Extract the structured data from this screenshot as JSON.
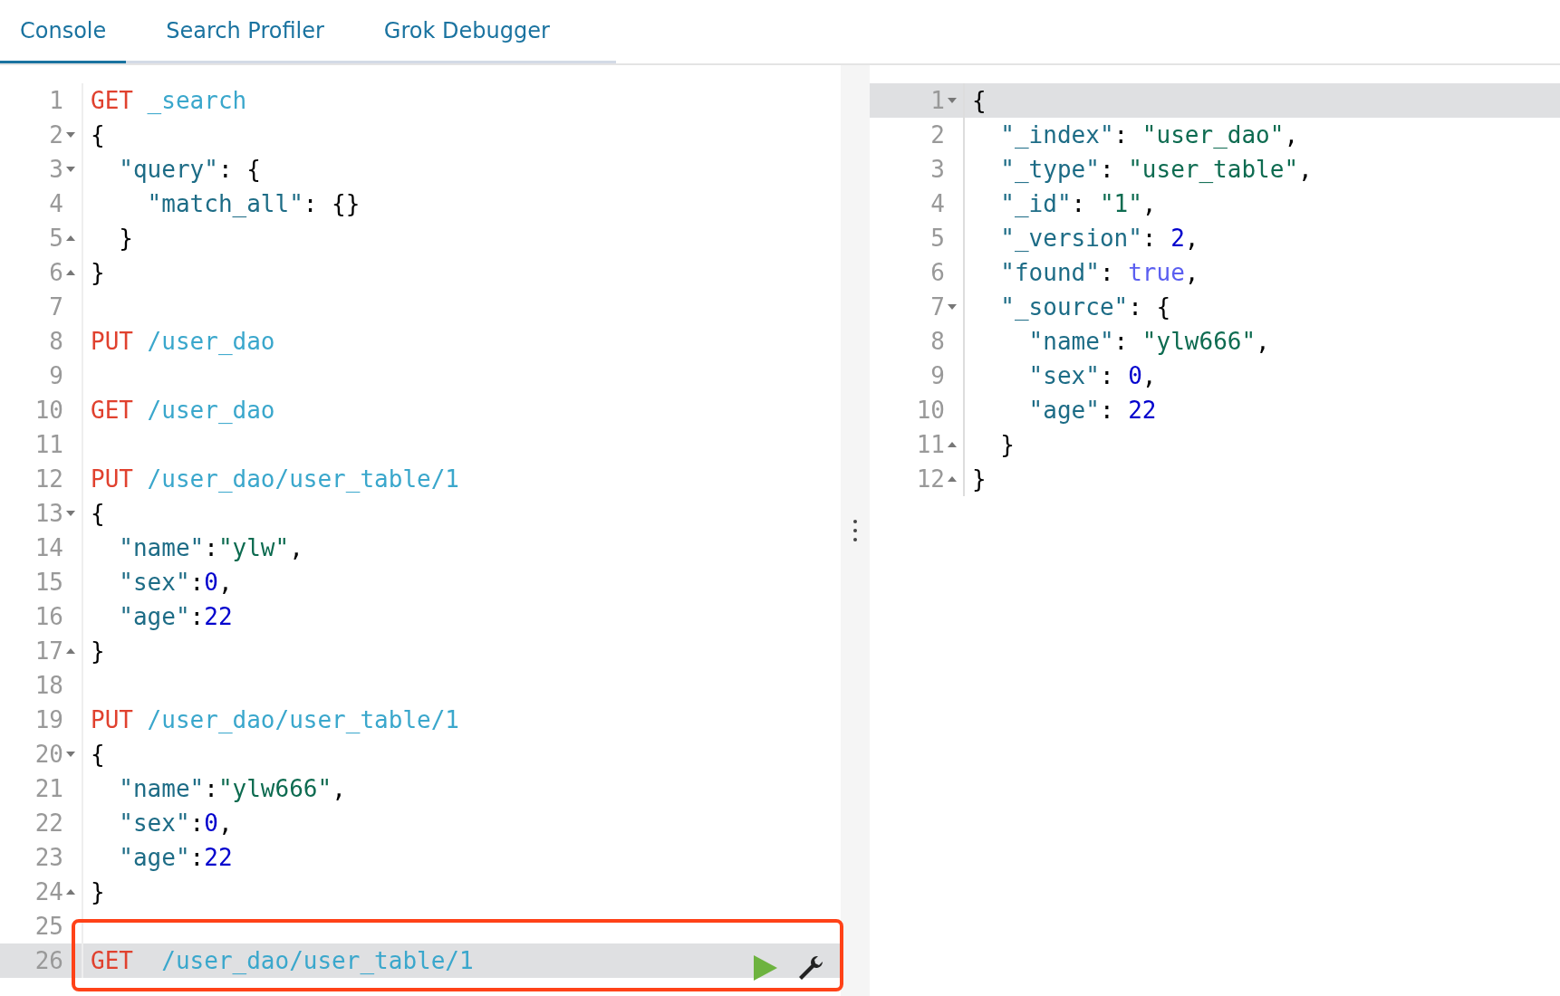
{
  "tabs": [
    {
      "label": "Console",
      "selected": true
    },
    {
      "label": "Search Profiler",
      "selected": false
    },
    {
      "label": "Grok Debugger",
      "selected": false
    }
  ],
  "request_editor": {
    "lines": [
      {
        "number": "1",
        "kind": "plain",
        "active": false,
        "tokens": [
          {
            "kind": "method",
            "text": "GET"
          },
          {
            "kind": "path",
            "text": " _search"
          }
        ]
      },
      {
        "number": "2",
        "kind": "fold-start",
        "active": false,
        "tokens": [
          {
            "kind": "punct",
            "text": "{"
          }
        ]
      },
      {
        "number": "3",
        "kind": "fold-start",
        "active": false,
        "tokens": [
          {
            "kind": "key",
            "text": "  \"query\""
          },
          {
            "kind": "punct",
            "text": ": {"
          }
        ]
      },
      {
        "number": "4",
        "kind": "plain",
        "active": false,
        "tokens": [
          {
            "kind": "key",
            "text": "    \"match_all\""
          },
          {
            "kind": "punct",
            "text": ": {}"
          }
        ]
      },
      {
        "number": "5",
        "kind": "fold-end",
        "active": false,
        "tokens": [
          {
            "kind": "punct",
            "text": "  }"
          }
        ]
      },
      {
        "number": "6",
        "kind": "fold-end",
        "active": false,
        "tokens": [
          {
            "kind": "punct",
            "text": "}"
          }
        ]
      },
      {
        "number": "7",
        "kind": "plain",
        "active": false
      },
      {
        "number": "8",
        "kind": "plain",
        "active": false,
        "tokens": [
          {
            "kind": "method",
            "text": "PUT"
          },
          {
            "kind": "path",
            "text": " /user_dao"
          }
        ]
      },
      {
        "number": "9",
        "kind": "plain",
        "active": false
      },
      {
        "number": "10",
        "kind": "plain",
        "active": false,
        "tokens": [
          {
            "kind": "method",
            "text": "GET"
          },
          {
            "kind": "path",
            "text": " /user_dao"
          }
        ]
      },
      {
        "number": "11",
        "kind": "plain",
        "active": false
      },
      {
        "number": "12",
        "kind": "plain",
        "active": false,
        "tokens": [
          {
            "kind": "method",
            "text": "PUT"
          },
          {
            "kind": "path",
            "text": " /user_dao/user_table/1"
          }
        ]
      },
      {
        "number": "13",
        "kind": "fold-start",
        "active": false,
        "tokens": [
          {
            "kind": "punct",
            "text": "{"
          }
        ]
      },
      {
        "number": "14",
        "kind": "plain",
        "active": false,
        "tokens": [
          {
            "kind": "key",
            "text": "  \"name\""
          },
          {
            "kind": "punct",
            "text": ":"
          },
          {
            "kind": "string",
            "text": "\"ylw\""
          },
          {
            "kind": "punct",
            "text": ","
          }
        ]
      },
      {
        "number": "15",
        "kind": "plain",
        "active": false,
        "tokens": [
          {
            "kind": "key",
            "text": "  \"sex\""
          },
          {
            "kind": "punct",
            "text": ":"
          },
          {
            "kind": "number",
            "text": "0"
          },
          {
            "kind": "punct",
            "text": ","
          }
        ]
      },
      {
        "number": "16",
        "kind": "plain",
        "active": false,
        "tokens": [
          {
            "kind": "key",
            "text": "  \"age\""
          },
          {
            "kind": "punct",
            "text": ":"
          },
          {
            "kind": "number",
            "text": "22"
          }
        ]
      },
      {
        "number": "17",
        "kind": "fold-end",
        "active": false,
        "tokens": [
          {
            "kind": "punct",
            "text": "}"
          }
        ]
      },
      {
        "number": "18",
        "kind": "plain",
        "active": false
      },
      {
        "number": "19",
        "kind": "plain",
        "active": false,
        "tokens": [
          {
            "kind": "method",
            "text": "PUT"
          },
          {
            "kind": "path",
            "text": " /user_dao/user_table/1"
          }
        ]
      },
      {
        "number": "20",
        "kind": "fold-start",
        "active": false,
        "tokens": [
          {
            "kind": "punct",
            "text": "{"
          }
        ]
      },
      {
        "number": "21",
        "kind": "plain",
        "active": false,
        "tokens": [
          {
            "kind": "key",
            "text": "  \"name\""
          },
          {
            "kind": "punct",
            "text": ":"
          },
          {
            "kind": "string",
            "text": "\"ylw666\""
          },
          {
            "kind": "punct",
            "text": ","
          }
        ]
      },
      {
        "number": "22",
        "kind": "plain",
        "active": false,
        "tokens": [
          {
            "kind": "key",
            "text": "  \"sex\""
          },
          {
            "kind": "punct",
            "text": ":"
          },
          {
            "kind": "number",
            "text": "0"
          },
          {
            "kind": "punct",
            "text": ","
          }
        ]
      },
      {
        "number": "23",
        "kind": "plain",
        "active": false,
        "tokens": [
          {
            "kind": "key",
            "text": "  \"age\""
          },
          {
            "kind": "punct",
            "text": ":"
          },
          {
            "kind": "number",
            "text": "22"
          }
        ]
      },
      {
        "number": "24",
        "kind": "fold-end",
        "active": false,
        "tokens": [
          {
            "kind": "punct",
            "text": "}"
          }
        ]
      },
      {
        "number": "25",
        "kind": "plain",
        "active": false
      },
      {
        "number": "26",
        "kind": "plain",
        "active": true,
        "tokens": [
          {
            "kind": "method",
            "text": "GET"
          },
          {
            "kind": "path",
            "text": "  /user_dao/user_table/1"
          }
        ]
      }
    ]
  },
  "response_editor": {
    "lines": [
      {
        "number": "1",
        "kind": "fold-start",
        "active": true,
        "tokens": [
          {
            "kind": "punct",
            "text": "{"
          }
        ]
      },
      {
        "number": "2",
        "kind": "plain",
        "active": false,
        "tokens": [
          {
            "kind": "key",
            "text": "  \"_index\""
          },
          {
            "kind": "punct",
            "text": ": "
          },
          {
            "kind": "string",
            "text": "\"user_dao\""
          },
          {
            "kind": "punct",
            "text": ","
          }
        ]
      },
      {
        "number": "3",
        "kind": "plain",
        "active": false,
        "tokens": [
          {
            "kind": "key",
            "text": "  \"_type\""
          },
          {
            "kind": "punct",
            "text": ": "
          },
          {
            "kind": "string",
            "text": "\"user_table\""
          },
          {
            "kind": "punct",
            "text": ","
          }
        ]
      },
      {
        "number": "4",
        "kind": "plain",
        "active": false,
        "tokens": [
          {
            "kind": "key",
            "text": "  \"_id\""
          },
          {
            "kind": "punct",
            "text": ": "
          },
          {
            "kind": "string",
            "text": "\"1\""
          },
          {
            "kind": "punct",
            "text": ","
          }
        ]
      },
      {
        "number": "5",
        "kind": "plain",
        "active": false,
        "tokens": [
          {
            "kind": "key",
            "text": "  \"_version\""
          },
          {
            "kind": "punct",
            "text": ": "
          },
          {
            "kind": "number",
            "text": "2"
          },
          {
            "kind": "punct",
            "text": ","
          }
        ]
      },
      {
        "number": "6",
        "kind": "plain",
        "active": false,
        "tokens": [
          {
            "kind": "key",
            "text": "  \"found\""
          },
          {
            "kind": "punct",
            "text": ": "
          },
          {
            "kind": "bool",
            "text": "true"
          },
          {
            "kind": "punct",
            "text": ","
          }
        ]
      },
      {
        "number": "7",
        "kind": "fold-start",
        "active": false,
        "tokens": [
          {
            "kind": "key",
            "text": "  \"_source\""
          },
          {
            "kind": "punct",
            "text": ": {"
          }
        ]
      },
      {
        "number": "8",
        "kind": "plain",
        "active": false,
        "tokens": [
          {
            "kind": "key",
            "text": "    \"name\""
          },
          {
            "kind": "punct",
            "text": ": "
          },
          {
            "kind": "string",
            "text": "\"ylw666\""
          },
          {
            "kind": "punct",
            "text": ","
          }
        ]
      },
      {
        "number": "9",
        "kind": "plain",
        "active": false,
        "tokens": [
          {
            "kind": "key",
            "text": "    \"sex\""
          },
          {
            "kind": "punct",
            "text": ": "
          },
          {
            "kind": "number",
            "text": "0"
          },
          {
            "kind": "punct",
            "text": ","
          }
        ]
      },
      {
        "number": "10",
        "kind": "plain",
        "active": false,
        "tokens": [
          {
            "kind": "key",
            "text": "    \"age\""
          },
          {
            "kind": "punct",
            "text": ": "
          },
          {
            "kind": "number",
            "text": "22"
          }
        ]
      },
      {
        "number": "11",
        "kind": "fold-end",
        "active": false,
        "tokens": [
          {
            "kind": "punct",
            "text": "  }"
          }
        ]
      },
      {
        "number": "12",
        "kind": "fold-end",
        "active": false,
        "tokens": [
          {
            "kind": "punct",
            "text": "}"
          }
        ]
      }
    ]
  }
}
